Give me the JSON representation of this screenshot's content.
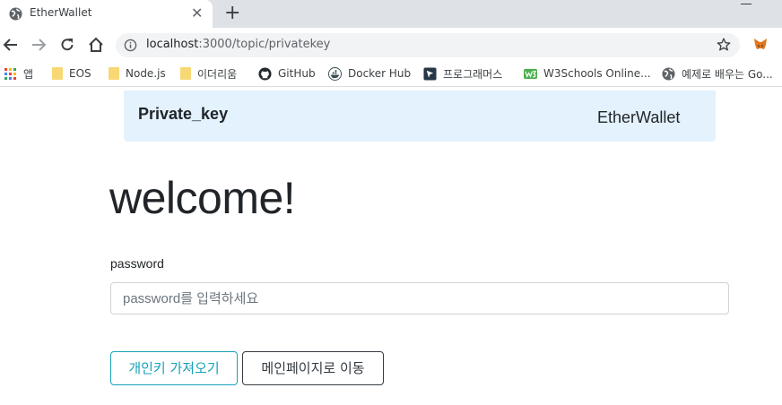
{
  "browser": {
    "tab_title": "EtherWallet",
    "tab_close": "✕",
    "new_tab": "+",
    "url_host": "localhost",
    "url_path": ":3000/topic/privatekey"
  },
  "bookmarks": [
    {
      "label": "앱",
      "icon": "apps-grid-icon"
    },
    {
      "label": "EOS",
      "icon": "folder-icon"
    },
    {
      "label": "Node.js",
      "icon": "folder-icon"
    },
    {
      "label": "이더리움",
      "icon": "folder-icon"
    },
    {
      "label": "GitHub",
      "icon": "github-icon"
    },
    {
      "label": "Docker Hub",
      "icon": "docker-icon"
    },
    {
      "label": "프로그래머스",
      "icon": "programmers-icon"
    },
    {
      "label": "W3Schools Online...",
      "icon": "w3schools-icon"
    },
    {
      "label": "예제로 배우는 Go...",
      "icon": "globe-icon"
    }
  ],
  "navbar": {
    "brand": "Private_key",
    "right_link": "EtherWallet",
    "bg_color": "#e3f2fd"
  },
  "main": {
    "heading": "welcome!",
    "password_label": "password",
    "password_placeholder": "password를 입력하세요",
    "fetch_button": "개인키 가져오기",
    "home_button": "메인페이지로 이동"
  },
  "colors": {
    "accent_info": "#17a2b8",
    "dark": "#343a40"
  }
}
